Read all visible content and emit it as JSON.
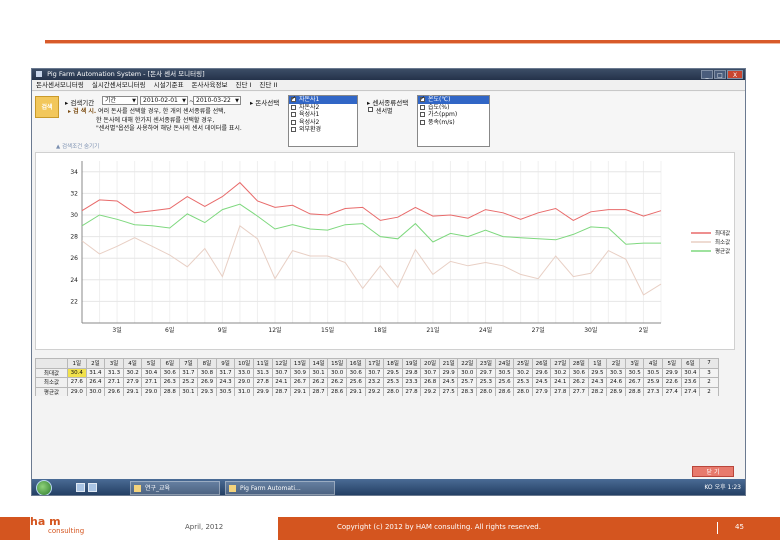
{
  "window": {
    "title": "Pig Farm Automation System - [돈사 센서 모니터링]",
    "buttons": [
      "_",
      "□",
      "X"
    ]
  },
  "menu": [
    "돈사센서모니터링",
    "실시간센서모니터링",
    "시설기준표",
    "돈사사육정보",
    "진단 I",
    "진단 II"
  ],
  "filter": {
    "search_label": "검색",
    "period_label": "▸ 검색기간",
    "period_type": "기간",
    "date_from": "2010-02-01",
    "date_to": "2010-03-22",
    "barn_label": "▸ 돈사선택",
    "sensor_type_label": "▸ 센서종류선택",
    "hint_title": "▸ 검 색 시.",
    "hint_lines": [
      "여러 돈사를 선택할 경우, 한 개의 센서종류를 선택,",
      "한 돈사에 대해 한가지 센서종류를 선택할 경우,",
      "\"센서별\"옵션을 사용하여 해당 돈사의 센서 데이터를 표시."
    ],
    "barns": [
      "자돈사1",
      "자돈사2",
      "육성사1",
      "육성사2",
      "외부환경"
    ],
    "sensor_opt": "센서별",
    "sensors": [
      "온도(℃)",
      "습도(%)",
      "가스(ppm)",
      "풍속(m/s)"
    ],
    "collapse_label": "▲ 검색조건 숨기기"
  },
  "chart_data": {
    "type": "line",
    "x_tick_labels": [
      "3일",
      "6일",
      "9일",
      "12일",
      "15일",
      "18일",
      "21일",
      "24일",
      "27일",
      "30일",
      "2일",
      "5일",
      "8일",
      "11일",
      "14일",
      "17일",
      "20일"
    ],
    "ylim": [
      20,
      35
    ],
    "yticks": [
      22,
      24,
      26,
      28,
      30,
      32,
      34
    ],
    "legend": [
      "최대값",
      "최소값",
      "평균값"
    ],
    "series": [
      {
        "name": "최대값",
        "color": "#e86a6a",
        "values": [
          30.4,
          31.4,
          31.3,
          30.2,
          30.4,
          30.6,
          31.7,
          30.8,
          31.7,
          33.0,
          31.3,
          30.7,
          30.9,
          30.1,
          30.0,
          30.6,
          30.7,
          29.5,
          29.8,
          30.7,
          29.9,
          30.0,
          29.7,
          30.5,
          30.2,
          29.6,
          30.2,
          30.6,
          29.5,
          30.3,
          30.5,
          30.5,
          29.9,
          30.4
        ]
      },
      {
        "name": "최소값",
        "color": "#e8cfc4",
        "values": [
          27.6,
          26.4,
          27.1,
          27.9,
          27.1,
          26.3,
          25.2,
          26.9,
          24.3,
          29.0,
          27.8,
          24.1,
          26.7,
          26.2,
          26.2,
          25.6,
          23.2,
          25.3,
          23.3,
          26.8,
          24.5,
          25.7,
          25.3,
          25.6,
          25.3,
          24.5,
          24.1,
          26.2,
          24.3,
          24.6,
          26.7,
          25.9,
          22.6,
          23.6
        ]
      },
      {
        "name": "평균값",
        "color": "#7ed87e",
        "values": [
          29.0,
          30.0,
          29.6,
          29.1,
          29.0,
          28.8,
          30.1,
          29.3,
          30.5,
          31.0,
          29.9,
          28.7,
          29.1,
          28.7,
          28.6,
          29.1,
          29.2,
          28.0,
          27.8,
          29.2,
          27.5,
          28.3,
          28.0,
          28.6,
          28.0,
          27.9,
          27.8,
          27.7,
          28.2,
          28.9,
          28.8,
          27.3,
          27.4,
          27.4
        ]
      }
    ]
  },
  "table": {
    "header": [
      "1일",
      "2일",
      "3일",
      "4일",
      "5일",
      "6일",
      "7일",
      "8일",
      "9일",
      "10일",
      "11일",
      "12일",
      "13일",
      "14일",
      "15일",
      "16일",
      "17일",
      "18일",
      "19일",
      "20일",
      "21일",
      "22일",
      "23일",
      "24일",
      "25일",
      "26일",
      "27일",
      "28일",
      "1일",
      "2일",
      "3일",
      "4일",
      "5일",
      "6일",
      "7"
    ],
    "rows": [
      {
        "label": "최대값",
        "cells": [
          "30.4",
          "31.4",
          "31.3",
          "30.2",
          "30.4",
          "30.6",
          "31.7",
          "30.8",
          "31.7",
          "33.0",
          "31.3",
          "30.7",
          "30.9",
          "30.1",
          "30.0",
          "30.6",
          "30.7",
          "29.5",
          "29.8",
          "30.7",
          "29.9",
          "30.0",
          "29.7",
          "30.5",
          "30.2",
          "29.6",
          "30.2",
          "30.6",
          "29.5",
          "30.3",
          "30.5",
          "30.5",
          "29.9",
          "30.4",
          "3"
        ]
      },
      {
        "label": "최소값",
        "cells": [
          "27.6",
          "26.4",
          "27.1",
          "27.9",
          "27.1",
          "26.3",
          "25.2",
          "26.9",
          "24.3",
          "29.0",
          "27.8",
          "24.1",
          "26.7",
          "26.2",
          "26.2",
          "25.6",
          "23.2",
          "25.3",
          "23.3",
          "26.8",
          "24.5",
          "25.7",
          "25.3",
          "25.6",
          "25.3",
          "24.5",
          "24.1",
          "26.2",
          "24.3",
          "24.6",
          "26.7",
          "25.9",
          "22.6",
          "23.6",
          "2"
        ]
      },
      {
        "label": "평균값",
        "cells": [
          "29.0",
          "30.0",
          "29.6",
          "29.1",
          "29.0",
          "28.8",
          "30.1",
          "29.3",
          "30.5",
          "31.0",
          "29.9",
          "28.7",
          "29.1",
          "28.7",
          "28.6",
          "29.1",
          "29.2",
          "28.0",
          "27.8",
          "29.2",
          "27.5",
          "28.3",
          "28.0",
          "28.6",
          "28.0",
          "27.9",
          "27.8",
          "27.7",
          "28.2",
          "28.9",
          "28.8",
          "27.3",
          "27.4",
          "27.4",
          "2"
        ]
      }
    ]
  },
  "close_button": "닫 기",
  "taskbar": {
    "items": [
      "연구_교육",
      "Pig Farm Automati..."
    ],
    "tray": "KO  오후 1:23"
  },
  "footer": {
    "logo": "ha m",
    "consulting": "consulting",
    "date": "April, 2012",
    "copyright": "Copyright (c) 2012 by HAM consulting. All rights reserved.",
    "page": "45"
  }
}
